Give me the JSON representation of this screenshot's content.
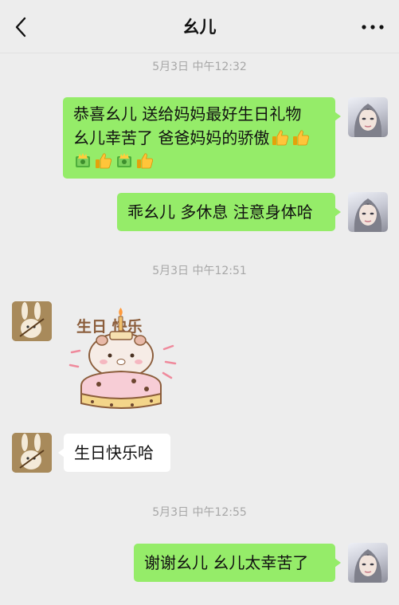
{
  "header": {
    "title": "幺儿",
    "back_icon": "chevron-left-icon",
    "more_icon": "more-dots-icon"
  },
  "messages": [
    {
      "type": "timestamp",
      "text": "5月3日 中午12:32"
    },
    {
      "type": "text",
      "side": "right",
      "lines": [
        "恭喜幺儿  送给妈妈最好生日礼物",
        "幺儿幸苦了 爸爸妈妈的骄傲"
      ],
      "emojis": [
        "thumbs-up-icon",
        "thumbs-up-icon",
        "money-icon",
        "thumbs-up-icon",
        "money-icon",
        "thumbs-up-icon"
      ]
    },
    {
      "type": "text",
      "side": "right",
      "text": "乖幺儿 多休息 注意身体哈"
    },
    {
      "type": "timestamp",
      "text": "5月3日 中午12:51"
    },
    {
      "type": "sticker",
      "side": "left",
      "text": "生日 快乐"
    },
    {
      "type": "text",
      "side": "left",
      "text": "生日快乐哈"
    },
    {
      "type": "timestamp",
      "text": "5月3日 中午12:55"
    },
    {
      "type": "text",
      "side": "right",
      "text": "谢谢幺儿  幺儿太幸苦了"
    }
  ],
  "colors": {
    "background": "#ededed",
    "bubble_self": "#95ec69",
    "bubble_peer": "#ffffff",
    "timestamp": "#a7a7a7"
  }
}
